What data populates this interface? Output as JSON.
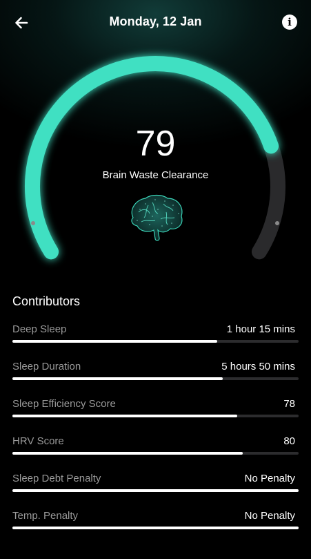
{
  "header": {
    "title": "Monday, 12 Jan",
    "back_icon": "arrow-left-icon",
    "info_icon": "info-icon",
    "info_glyph": "i"
  },
  "score": {
    "value": "79",
    "fraction": 0.79,
    "label": "Brain Waste Clearance",
    "image": "brain-image"
  },
  "colors": {
    "accent": "#3fe0c2",
    "track": "#2a2a2c",
    "bar_fill": "#ffffff",
    "bar_track": "#2c2c2e"
  },
  "contributors": {
    "title": "Contributors",
    "items": [
      {
        "label": "Deep Sleep",
        "value": "1 hour 15 mins",
        "progress": 0.715
      },
      {
        "label": "Sleep Duration",
        "value": "5 hours 50 mins",
        "progress": 0.735
      },
      {
        "label": "Sleep Efficiency Score",
        "value": "78",
        "progress": 0.785
      },
      {
        "label": "HRV Score",
        "value": "80",
        "progress": 0.805
      },
      {
        "label": "Sleep Debt Penalty",
        "value": "No Penalty",
        "progress": 1.0
      },
      {
        "label": "Temp. Penalty",
        "value": "No Penalty",
        "progress": 1.0
      }
    ]
  }
}
